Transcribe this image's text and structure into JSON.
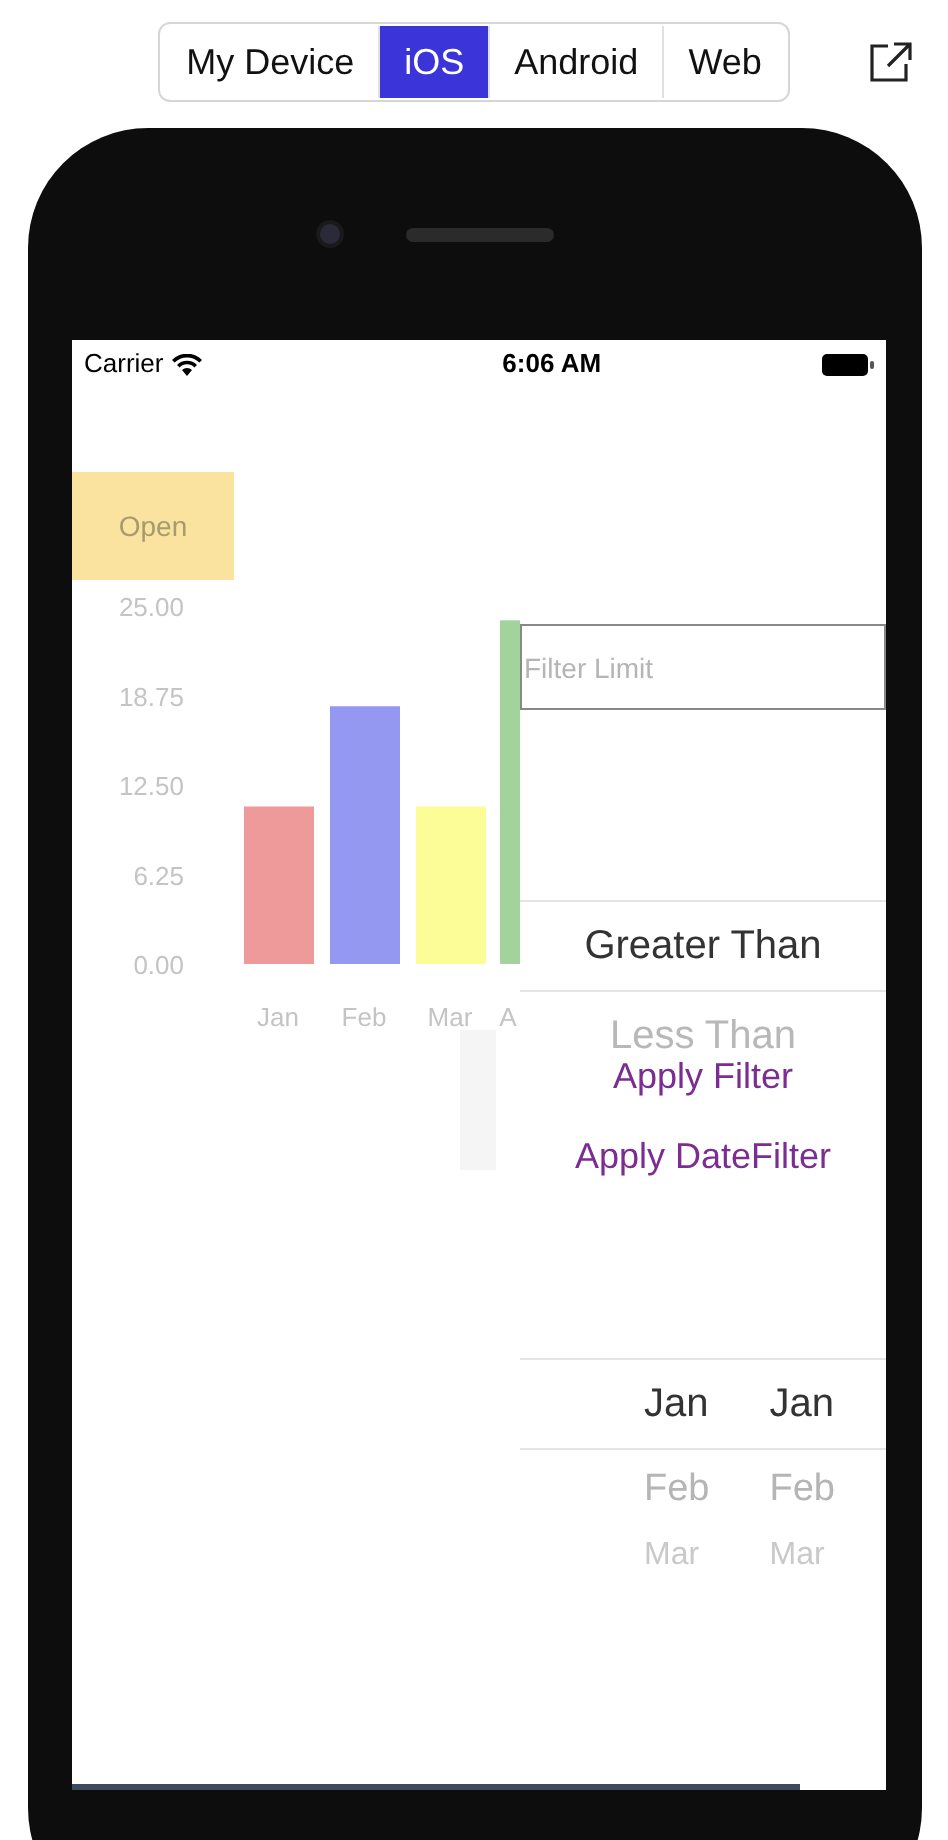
{
  "platform_tabs": [
    {
      "label": "My Device",
      "selected": false
    },
    {
      "label": "iOS",
      "selected": true
    },
    {
      "label": "Android",
      "selected": false
    },
    {
      "label": "Web",
      "selected": false
    }
  ],
  "status_bar": {
    "carrier": "Carrier",
    "time": "6:06 AM"
  },
  "legend": {
    "label": "Open",
    "color": "#fae29f"
  },
  "chart_data": {
    "type": "bar",
    "categories": [
      "Jan",
      "Feb",
      "Mar",
      "A"
    ],
    "series": [
      {
        "color": "#ef9a9a",
        "values": [
          11,
          null,
          null,
          null
        ]
      },
      {
        "color": "#9598f0",
        "values": [
          null,
          18,
          null,
          null
        ]
      },
      {
        "color": "#fdfd98",
        "values": [
          null,
          null,
          11,
          null
        ]
      },
      {
        "color": "#a3d39c",
        "values": [
          null,
          null,
          null,
          24
        ]
      }
    ],
    "ylim": [
      0,
      25
    ],
    "yticks": [
      {
        "value": 25,
        "label": "25.00"
      },
      {
        "value": 18.75,
        "label": "18.75"
      },
      {
        "value": 12.5,
        "label": "12.50"
      },
      {
        "value": 6.25,
        "label": "6.25"
      },
      {
        "value": 0,
        "label": "0.00"
      }
    ]
  },
  "filter_limit": {
    "placeholder": "Filter Limit"
  },
  "comparison_picker": [
    {
      "label": "Greater Than",
      "selected": true
    },
    {
      "label": "Less Than",
      "selected": false
    }
  ],
  "buttons": [
    "Apply Filter",
    "Apply DateFilter"
  ],
  "date_picker": {
    "columns": [
      {
        "items": [
          "Jan",
          "Feb",
          "Mar"
        ]
      },
      {
        "items": [
          "Jan",
          "Feb",
          "Mar"
        ]
      }
    ]
  }
}
